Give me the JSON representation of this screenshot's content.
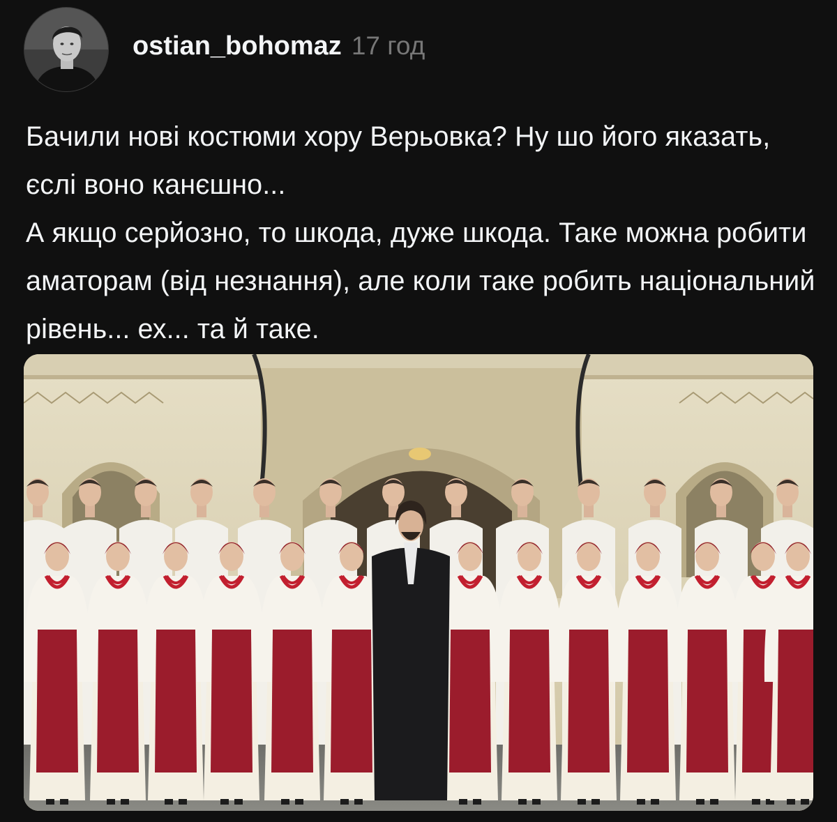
{
  "post": {
    "username": "ostian_bohomaz",
    "timestamp": "17 год",
    "paragraphs": [
      "Бачили нові костюми хору Верьовка? Ну шо його яказать, єслі воно канєшно...",
      "А якщо серйозно, то шкода, дуже шкода. Таке можна робити аматорам (від незнання), але коли таке робить національний рівень... ех... та й таке."
    ]
  },
  "colors": {
    "background": "#101010",
    "text_primary": "#f3f5f7",
    "text_secondary": "#777777"
  }
}
